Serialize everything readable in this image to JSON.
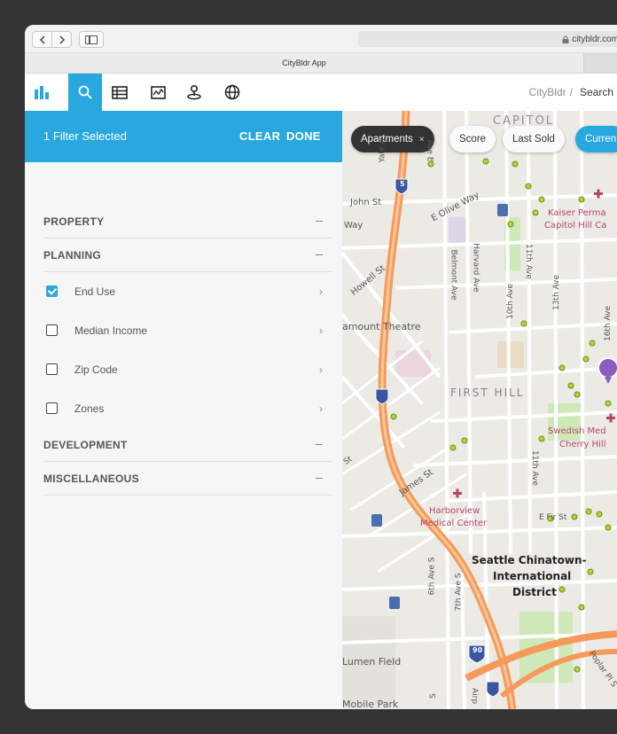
{
  "browser": {
    "url": "citybldr.com",
    "tab_title": "CityBldr App",
    "back_icon": "chevron-left-icon",
    "forward_icon": "chevron-right-icon"
  },
  "toolbar": {
    "tools": [
      "logo-bars-icon",
      "search-icon",
      "table-icon",
      "chart-icon",
      "map-pin-user-icon",
      "globe-icon"
    ],
    "breadcrumb_app": "CityBldr",
    "breadcrumb_sep": "/",
    "breadcrumb_page": "Search"
  },
  "filter_panel": {
    "count_label": "1 Filter Selected",
    "clear_label": "CLEAR",
    "done_label": "DONE",
    "sections": {
      "property": "PROPERTY",
      "planning": "PLANNING",
      "development": "DEVELOPMENT",
      "miscellaneous": "MISCELLANEOUS"
    },
    "planning_items": [
      {
        "label": "End Use",
        "checked": true
      },
      {
        "label": "Median Income",
        "checked": false
      },
      {
        "label": "Zip Code",
        "checked": false
      },
      {
        "label": "Zones",
        "checked": false
      }
    ],
    "chevron": "›",
    "collapse_symbol": "–"
  },
  "map": {
    "chips": {
      "apartments": "Apartments",
      "apartments_remove": "×",
      "score": "Score",
      "last_sold": "Last Sold",
      "current": "Curren"
    },
    "labels": {
      "capitol": "CAPITOL",
      "john_st": "John St",
      "olive_way": "E Olive Way",
      "way": "Way",
      "kaiser": "Kaiser Perma",
      "capitol_hill": "Capitol Hill Ca",
      "howell": "Howell St",
      "belmont": "Belmont Ave",
      "harvard": "Harvard Ave",
      "ave10": "10th Ave",
      "ave11": "11th Ave",
      "ave13": "13th Ave",
      "ave16": "16th Ave",
      "theatre": "amount Theatre",
      "first_hill": "FIRST HILL",
      "swedish": "Swedish Med",
      "cherry_hill": "Cherry Hill",
      "james": "James St",
      "harborview": "Harborview",
      "medical": "Medical Center",
      "e_fir": "E Fir St",
      "chinatown1": "Seattle Chinatown-",
      "chinatown2": "International",
      "chinatown3": "District",
      "ave6": "6th Ave S",
      "ave7": "7th Ave S",
      "lumen": "Lumen Field",
      "mobile": "Mobile Park",
      "poplar": "Poplar Pl S",
      "yale": "Yale A",
      "ave_e": "Ave E",
      "st": "St",
      "i5": "5",
      "i90": "90",
      "hw11": "11th Ave",
      "ave_s": "S",
      "air": "Airp"
    }
  },
  "colors": {
    "accent": "#29a8e0",
    "freeway": "#f59a5a",
    "park": "#cfe8b8",
    "pin_purple": "#8b5cbf",
    "hospital": "#b5456b"
  }
}
